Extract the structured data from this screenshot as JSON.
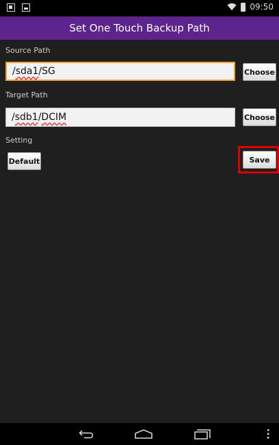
{
  "status_bar": {
    "time": "09:50",
    "left_icons": [
      "notification-icon",
      "image-icon"
    ],
    "right_icons": [
      "wifi-icon",
      "battery-icon"
    ]
  },
  "title_bar": {
    "title": "Set One Touch Backup Path",
    "color": "#5c248c"
  },
  "source": {
    "label": "Source Path",
    "prefix": "/",
    "underlined": "sda1",
    "suffix": "/SG",
    "choose_label": "Choose"
  },
  "target": {
    "label": "Target Path",
    "prefix": "/",
    "underlined_1": "sdb1",
    "separator": "/",
    "underlined_2": "DCIM",
    "choose_label": "Choose"
  },
  "setting": {
    "label": "Setting",
    "default_label": "Default",
    "save_label": "Save"
  },
  "nav_bar": {
    "buttons": [
      "back-icon",
      "home-icon",
      "recent-apps-icon",
      "menu-icon"
    ]
  }
}
